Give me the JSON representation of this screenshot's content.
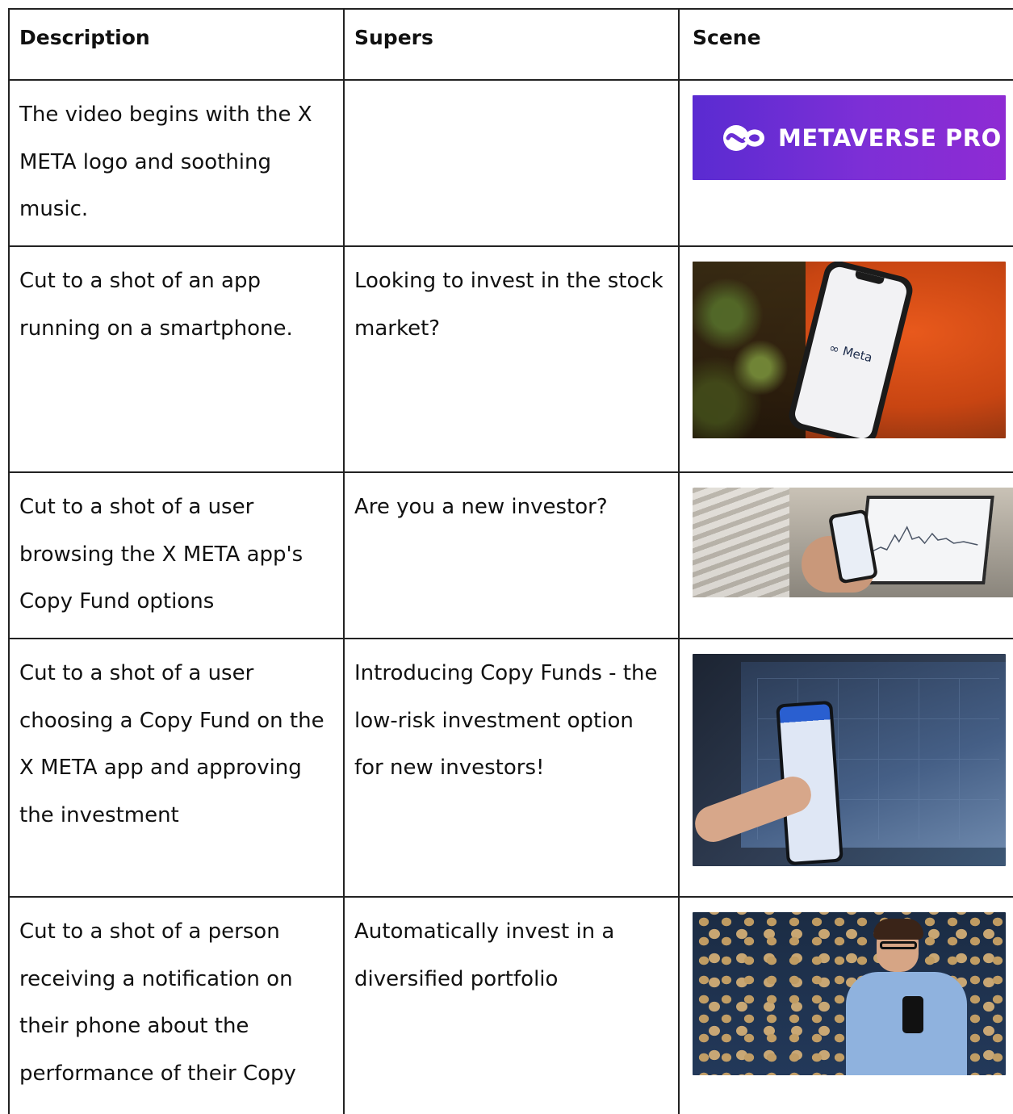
{
  "headers": {
    "description": "Description",
    "supers": "Supers",
    "scene": "Scene"
  },
  "rows": [
    {
      "description": "The video begins with the X META logo and soothing music.",
      "supers": "",
      "scene_text": "METAVERSE PRO"
    },
    {
      "description": "Cut to a shot of an app running on a smartphone.",
      "supers": "Looking to invest in the stock market?",
      "scene_text": "Meta"
    },
    {
      "description": "Cut to a shot of a user browsing the X META app's Copy Fund options",
      "supers": "Are you a new investor?",
      "scene_text": ""
    },
    {
      "description": "Cut to a shot of a user choosing a Copy Fund on the X META app and approving the investment",
      "supers": "Introducing Copy Funds - the low-risk investment option for new investors!",
      "scene_text": ""
    },
    {
      "description": "Cut to a shot of a person receiving a notification on their phone about the performance of their Copy",
      "supers": "Automatically invest in a diversified portfolio",
      "scene_text": ""
    }
  ],
  "colors": {
    "logo_bg_start": "#5a2bd1",
    "logo_bg_end": "#8e2bd3",
    "border": "#222222"
  },
  "icons": [
    "metaverse-logo-icon",
    "meta-infinity-icon"
  ]
}
